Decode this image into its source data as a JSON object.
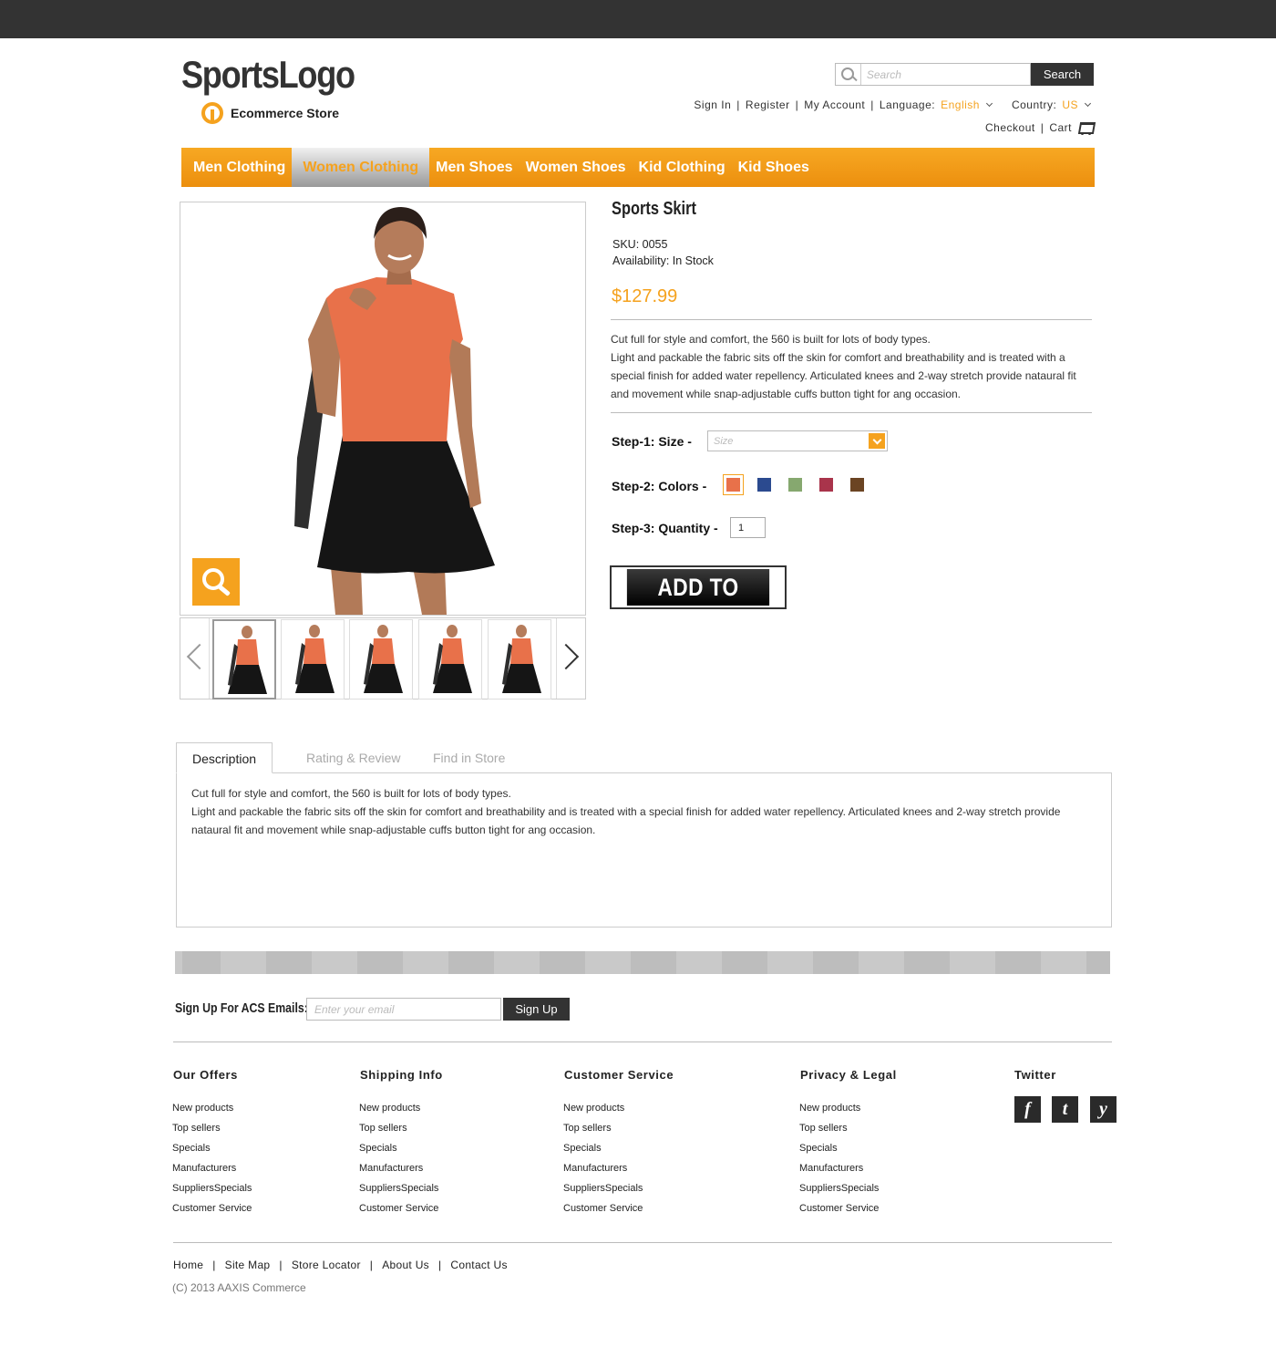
{
  "header": {
    "logo": "SportsLogo",
    "tagline": "Ecommerce Store",
    "search_placeholder": "Search",
    "search_button": "Search",
    "links": {
      "sign_in": "Sign In",
      "register": "Register",
      "my_account": "My Account",
      "language_label": "Language:",
      "language_value": "English",
      "country_label": "Country:",
      "country_value": "US",
      "checkout": "Checkout",
      "cart": "Cart"
    }
  },
  "nav": {
    "items": [
      "Men Clothing",
      "Women Clothing",
      "Men Shoes",
      "Women Shoes",
      "Kid Clothing",
      "Kid Shoes"
    ],
    "active": "Women Clothing"
  },
  "product": {
    "title": "Sports Skirt",
    "sku": "SKU: 0055",
    "availability": "Availability: In Stock",
    "price": "$127.99",
    "description_line1": "Cut full for style and comfort, the 560 is built for lots of body types.",
    "description_line2": "Light and packable the fabric sits off the skin for comfort and breathability and is treated with a special finish for added water repellency. Articulated knees and 2-way stretch provide nataural fit and movement while snap-adjustable cuffs button tight for ang occasion.",
    "step1_label": "Step-1: Size -",
    "size_placeholder": "Size",
    "step2_label": "Step-2: Colors -",
    "colors": [
      "#e8714a",
      "#2b4a8f",
      "#86a86f",
      "#a9344b",
      "#6b4423"
    ],
    "selected_color": "#e8714a",
    "step3_label": "Step-3: Quantity -",
    "quantity": "1",
    "add_to_cart": "ADD TO CART"
  },
  "tabs": {
    "items": [
      "Description",
      "Rating & Review",
      "Find in Store"
    ],
    "active": "Description",
    "panel_line1": "Cut full for style and comfort, the 560 is built for lots of body types.",
    "panel_line2": "Light and packable the fabric sits off the skin for comfort and breathability and is treated with a special finish for added water repellency. Articulated knees and 2-way stretch provide nataural fit and movement while snap-adjustable cuffs button tight for ang occasion."
  },
  "signup": {
    "label": "Sign Up For ACS Emails:",
    "placeholder": "Enter your email",
    "button": "Sign Up"
  },
  "footer": {
    "columns": [
      {
        "title": "Our Offers",
        "links": [
          "New products",
          "Top sellers",
          "Specials",
          "Manufacturers",
          "SuppliersSpecials",
          "Customer Service"
        ]
      },
      {
        "title": "Shipping Info",
        "links": [
          "New products",
          "Top sellers",
          "Specials",
          "Manufacturers",
          "SuppliersSpecials",
          "Customer Service"
        ]
      },
      {
        "title": "Customer Service",
        "links": [
          "New products",
          "Top sellers",
          "Specials",
          "Manufacturers",
          "SuppliersSpecials",
          "Customer Service"
        ]
      },
      {
        "title": "Privacy & Legal",
        "links": [
          "New products",
          "Top sellers",
          "Specials",
          "Manufacturers",
          "SuppliersSpecials",
          "Customer Service"
        ]
      }
    ],
    "twitter_title": "Twitter",
    "social": [
      "f",
      "t",
      "y"
    ],
    "bottom_links": [
      "Home",
      "Site Map",
      "Store Locator",
      "About Us",
      "Contact Us"
    ],
    "copyright": "(C) 2013 AAXIS Commerce"
  },
  "colors": {
    "accent": "#f5a21e",
    "dark": "#333333"
  }
}
